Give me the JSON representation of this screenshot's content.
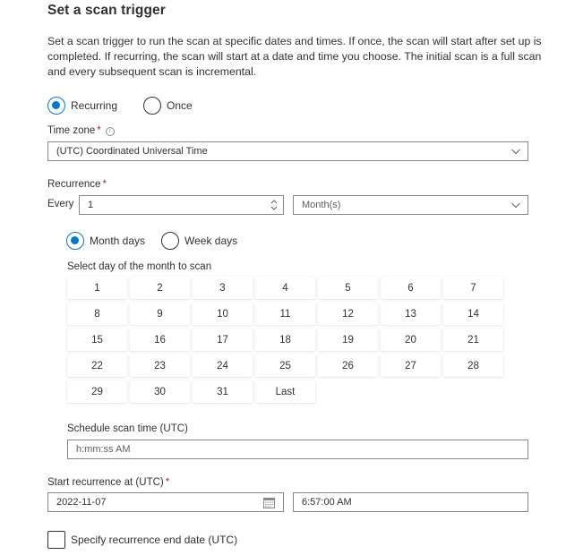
{
  "section": {
    "title": "Set a scan trigger",
    "description": "Set a scan trigger to run the scan at specific dates and times. If once, the scan will start after set up is completed. If recurring, the scan will start at a date and time you choose. The initial scan is a full scan and every subsequent scan is incremental."
  },
  "trigger_type": {
    "options": [
      {
        "label": "Recurring",
        "selected": true
      },
      {
        "label": "Once",
        "selected": false
      }
    ]
  },
  "time_zone": {
    "label": "Time zone",
    "required_mark": "*",
    "info_icon": "info-icon",
    "value": "(UTC) Coordinated Universal Time"
  },
  "recurrence": {
    "label": "Recurrence",
    "required_mark": "*",
    "every_label": "Every",
    "interval_value": "1",
    "unit_value": "Month(s)"
  },
  "day_mode": {
    "options": [
      {
        "label": "Month days",
        "selected": true
      },
      {
        "label": "Week days",
        "selected": false
      }
    ]
  },
  "month_days": {
    "label": "Select day of the month to scan",
    "days": [
      "1",
      "2",
      "3",
      "4",
      "5",
      "6",
      "7",
      "8",
      "9",
      "10",
      "11",
      "12",
      "13",
      "14",
      "15",
      "16",
      "17",
      "18",
      "19",
      "20",
      "21",
      "22",
      "23",
      "24",
      "25",
      "26",
      "27",
      "28",
      "29",
      "30",
      "31",
      "Last"
    ]
  },
  "schedule_time": {
    "label": "Schedule scan time (UTC)",
    "placeholder": "h:mm:ss AM",
    "value": ""
  },
  "start_recurrence": {
    "label": "Start recurrence at (UTC)",
    "required_mark": "*",
    "date_value": "2022-11-07",
    "time_value": "6:57:00 AM"
  },
  "end_date": {
    "label": "Specify recurrence end date (UTC)",
    "checked": false
  },
  "colors": {
    "accent": "#0078d4",
    "text": "#323130",
    "border": "#8a8886",
    "required": "#a4262c"
  }
}
